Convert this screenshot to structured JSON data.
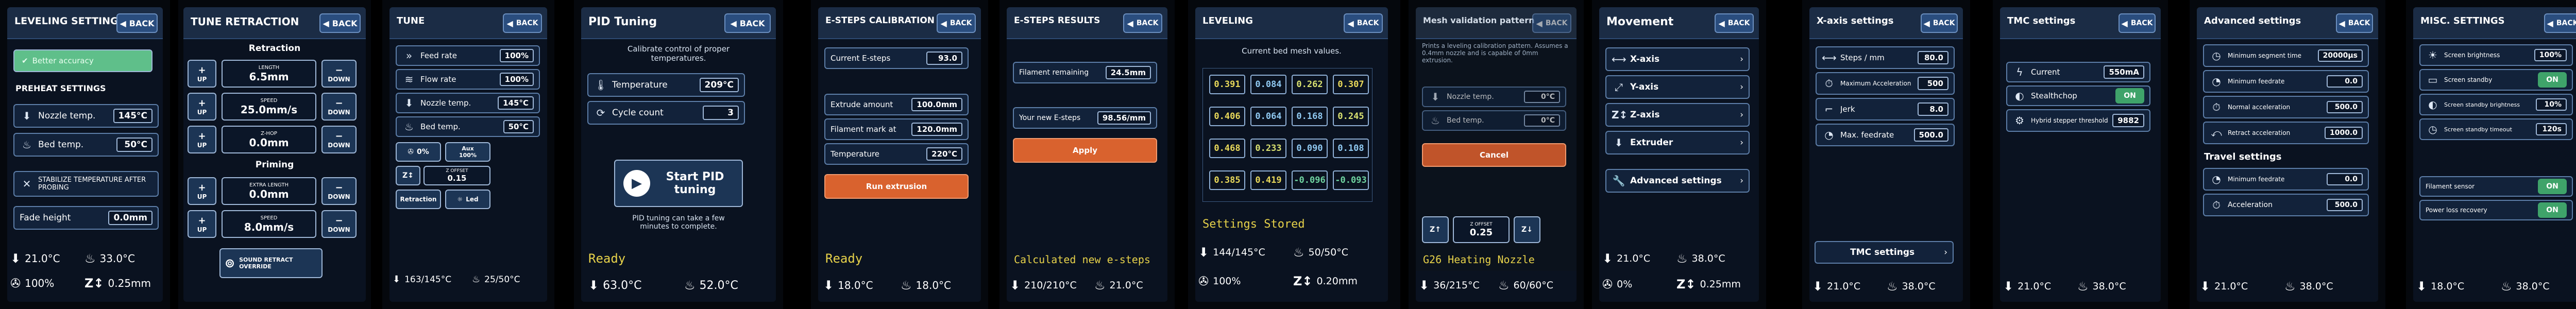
{
  "common": {
    "back_label": "BACK"
  },
  "p1": {
    "title": "LEVELING SETTINGS",
    "bed_accuracy": "Better accuracy",
    "preheat_title": "PREHEAT SETTINGS",
    "nozzle_label": "Nozzle temp.",
    "nozzle_value": "145°C",
    "bed_label": "Bed temp.",
    "bed_value": "50°C",
    "stabilize_label": "STABILIZE TEMPERATURE AFTER PROBING",
    "fade_label": "Fade height",
    "fade_value": "0.0mm",
    "footer_nozzle": "21.0°C",
    "footer_bed": "33.0°C",
    "footer_fan": "100%",
    "footer_z": "0.25mm"
  },
  "p2": {
    "title": "TUNE RETRACTION",
    "retraction_title": "Retraction",
    "length_label": "LENGTH",
    "length_value": "6.5mm",
    "speed_label": "SPEED",
    "speed_value": "25.0mm/s",
    "zhop_label": "Z-HOP",
    "zhop_value": "0.0mm",
    "priming_title": "Priming",
    "extra_label": "EXTRA LENGTH",
    "extra_value": "0.0mm",
    "pspeed_label": "SPEED",
    "pspeed_value": "8.0mm/s",
    "up_label": "UP",
    "down_label": "DOWN",
    "sound_label": "SOUND RETRACT OVERRIDE"
  },
  "p3": {
    "title": "TUNE",
    "items": [
      {
        "label": "Feed rate",
        "value": "100%"
      },
      {
        "label": "Flow rate",
        "value": "100%"
      },
      {
        "label": "Nozzle temp.",
        "value": "145°C"
      },
      {
        "label": "Bed temp.",
        "value": "50°C"
      }
    ],
    "fan_value": "0%",
    "aux_label": "Aux",
    "aux_value": "100%",
    "zoffset_label": "Z OFFSET",
    "zoffset_value": "0.15",
    "retraction_label": "Retraction",
    "led_label": "Led",
    "footer_nozzle": "163/145°C",
    "footer_bed": "25/50°C"
  },
  "p4": {
    "title": "PID Tuning",
    "subtitle": "Calibrate control of proper temperatures.",
    "temp_label": "Temperature",
    "temp_value": "209°C",
    "cycle_label": "Cycle count",
    "cycle_value": "3",
    "start_label": "Start PID tuning",
    "note": "PID tuning can take a few minutes to complete.",
    "status": "Ready",
    "footer_nozzle": "63.0°C",
    "footer_bed": "52.0°C"
  },
  "p5": {
    "title": "E-STEPS CALIBRATION",
    "current_label": "Current E-steps",
    "current_value": "93.0",
    "extrude_label": "Extrude amount",
    "extrude_value": "100.0mm",
    "mark_label": "Filament mark at",
    "mark_value": "120.0mm",
    "temp_label": "Temperature",
    "temp_value": "220°C",
    "run_label": "Run extrusion",
    "status": "Ready",
    "footer_nozzle": "18.0°C",
    "footer_bed": "18.0°C"
  },
  "p6": {
    "title": "E-STEPS RESULTS",
    "remaining_label": "Filament remaining",
    "remaining_value": "24.5mm",
    "new_label": "Your new E-steps",
    "new_value": "98.56/mm",
    "apply_label": "Apply",
    "status": "Calculated new e-steps",
    "footer_nozzle": "210/210°C",
    "footer_bed": "21.0°C"
  },
  "p7": {
    "title": "LEVELING",
    "subtitle": "Current bed mesh values.",
    "mesh": [
      [
        "0.391",
        "0.084",
        "0.262",
        "0.307"
      ],
      [
        "0.406",
        "0.064",
        "0.168",
        "0.245"
      ],
      [
        "0.468",
        "0.233",
        "0.090",
        "0.108"
      ],
      [
        "0.385",
        "0.419",
        "-0.096",
        "-0.093"
      ]
    ],
    "status": "Settings Stored",
    "footer_nozzle": "144/145°C",
    "footer_bed": "50/50°C",
    "footer_fan": "100%",
    "footer_z": "0.20mm"
  },
  "p8": {
    "title": "Mesh validation pattern",
    "desc": "Prints a leveling calibration pattern. Assumes a 0.4mm nozzle and is capable of 0mm extrusion.",
    "nozzle_label": "Nozzle temp.",
    "nozzle_value": "0°C",
    "bed_label": "Bed temp.",
    "bed_value": "0°C",
    "cancel_label": "Cancel",
    "zoffset_label": "Z OFFSET",
    "zoffset_value": "0.25",
    "status": "G26 Heating Nozzle",
    "footer_nozzle": "36/215°C",
    "footer_bed": "60/60°C"
  },
  "p9": {
    "title": "Movement",
    "items": [
      "X-axis",
      "Y-axis",
      "Z-axis",
      "Extruder"
    ],
    "advanced_label": "Advanced settings",
    "footer_nozzle": "21.0°C",
    "footer_bed": "38.0°C",
    "footer_fan": "0%",
    "footer_z": "0.25mm"
  },
  "p10": {
    "title": "X-axis settings",
    "items": [
      {
        "label": "Steps / mm",
        "value": "80.0"
      },
      {
        "label": "Maximum Acceleration",
        "value": "500"
      },
      {
        "label": "Jerk",
        "value": "8.0"
      },
      {
        "label": "Max. feedrate",
        "value": "500.0"
      }
    ],
    "tmc_label": "TMC settings",
    "footer_nozzle": "21.0°C",
    "footer_bed": "38.0°C"
  },
  "p11": {
    "title": "TMC settings",
    "current_label": "Current",
    "current_value": "550mA",
    "stealth_label": "Stealthchop",
    "stealth_value": "ON",
    "hybrid_label": "Hybrid stepper threshold",
    "hybrid_value": "9882",
    "footer_nozzle": "21.0°C",
    "footer_bed": "38.0°C"
  },
  "p12": {
    "title": "Advanced settings",
    "items": [
      {
        "label": "Minimum segment time",
        "value": "20000µs"
      },
      {
        "label": "Minimum feedrate",
        "value": "0.0"
      },
      {
        "label": "Normal acceleration",
        "value": "500.0"
      },
      {
        "label": "Retract acceleration",
        "value": "1000.0"
      }
    ],
    "travel_title": "Travel settings",
    "travel_items": [
      {
        "label": "Minimum feedrate",
        "value": "0.0"
      },
      {
        "label": "Acceleration",
        "value": "500.0"
      }
    ],
    "footer_nozzle": "21.0°C",
    "footer_bed": "38.0°C"
  },
  "p13": {
    "title": "MISC. SETTINGS",
    "items": [
      {
        "label": "Screen brightness",
        "value": "100%"
      },
      {
        "label": "Screen standby",
        "value": "ON"
      },
      {
        "label": "Screen standby brightness",
        "value": "10%"
      },
      {
        "label": "Screen standby timeout",
        "value": "120s"
      }
    ],
    "sensor_label": "Filament sensor",
    "sensor_value": "ON",
    "power_label": "Power loss recovery",
    "power_value": "ON",
    "footer_nozzle": "18.0°C",
    "footer_bed": "38.0°C"
  }
}
